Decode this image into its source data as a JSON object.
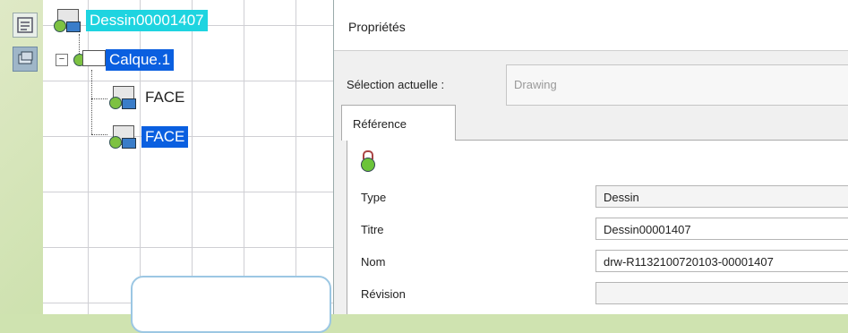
{
  "tree": {
    "root_label": "Dessin00001407",
    "layer_label": "Calque.1",
    "children": [
      {
        "label": "FACE",
        "selected": false
      },
      {
        "label": "FACE",
        "selected": true
      }
    ],
    "expander_symbol": "−"
  },
  "dialog": {
    "title": "Propriétés",
    "current_selection_label": "Sélection actuelle :",
    "current_selection_value": "Drawing",
    "tabs": [
      {
        "label": "Référence"
      }
    ],
    "properties": [
      {
        "label": "Type",
        "value": "Dessin"
      },
      {
        "label": "Titre",
        "value": "Dessin00001407"
      },
      {
        "label": "Nom",
        "value": "drw-R1132100720103-00001407"
      },
      {
        "label": "Révision",
        "value": ""
      }
    ]
  },
  "colors": {
    "selection_cyan": "#1ed4e0",
    "selection_blue": "#0a5fe0"
  },
  "icons": [
    "tree-toggle-icon",
    "layers-icon",
    "drawing-icon",
    "face-icon",
    "lock-icon"
  ]
}
